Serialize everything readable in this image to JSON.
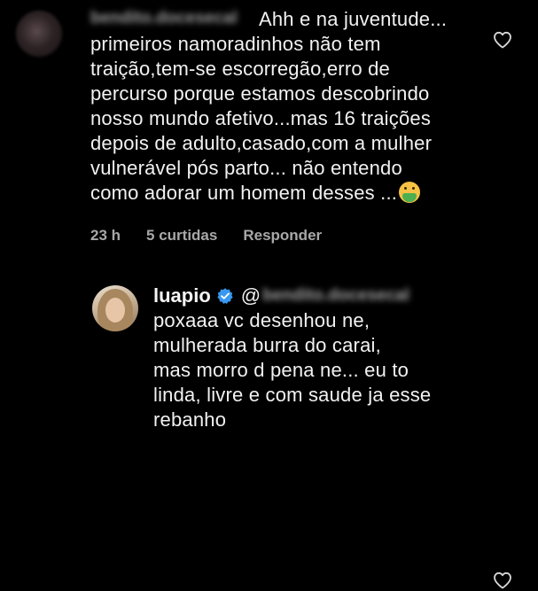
{
  "comment": {
    "username_blurred": "bendito.docesecal",
    "text_first_line": "Ahh e na juventude...",
    "text_lines": [
      "primeiros namoradinhos não tem",
      "traição,tem-se escorregão,erro de",
      "percurso porque estamos descobrindo",
      "nosso mundo afetivo...mas 16 traições",
      "depois de adulto,casado,com a mulher",
      "vulnerável pós parto... não entendo",
      "como adorar um homem desses ..."
    ],
    "emoji": "sick-face-icon",
    "time": "23 h",
    "likes": "5 curtidas",
    "reply_label": "Responder"
  },
  "reply": {
    "username": "luapio",
    "mention_prefix": "@",
    "mention_blurred": "bendito.docesecal",
    "text_lines": [
      "poxaaa vc desenhou ne,",
      "mulherada burra do carai,",
      "mas morro d pena ne... eu to",
      "linda, livre e com saude ja esse",
      "rebanho"
    ]
  },
  "colors": {
    "background": "#000000",
    "text": "#f2f2f2",
    "meta": "#a8a8a8",
    "verified": "#3897f0"
  }
}
